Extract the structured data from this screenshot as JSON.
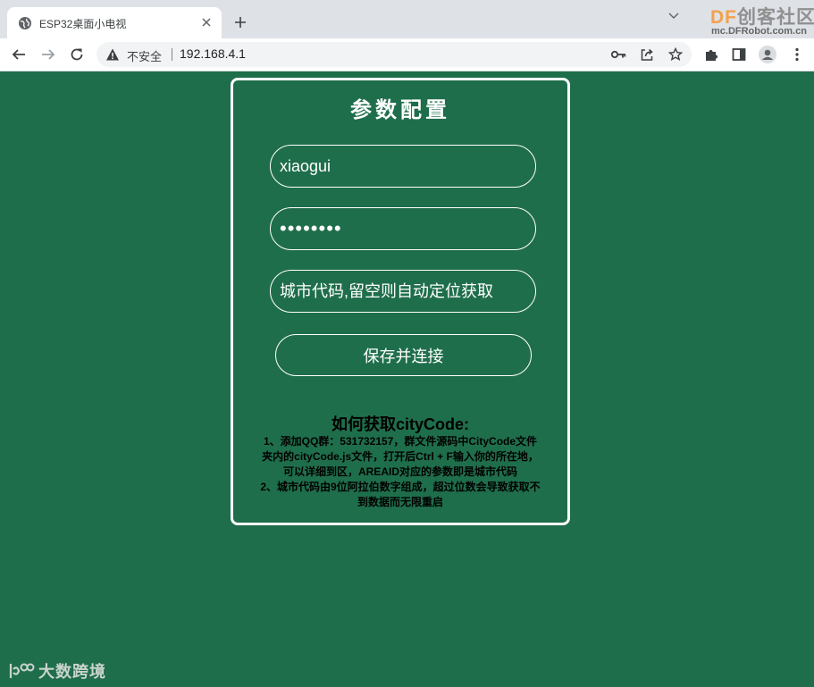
{
  "browser": {
    "tab_title": "ESP32桌面小电视",
    "security_label": "不安全",
    "url": "192.168.4.1"
  },
  "watermark": {
    "logo_prefix": "DF",
    "logo_suffix": "创客社区",
    "url": "mc.DFRobot.com.cn",
    "bottom_text": "大数跨境"
  },
  "colors": {
    "page_background": "#1f6e4b",
    "card_border": "#ffffff",
    "watermark_accent": "#f2a14b"
  },
  "form": {
    "title": "参数配置",
    "ssid_value": "xiaogui",
    "password_value": "12345678",
    "city_code_value": "",
    "city_code_placeholder": "城市代码,留空则自动定位获取",
    "save_button": "保存并连接"
  },
  "help": {
    "title": "如何获取cityCode:",
    "lines": [
      "1、添加QQ群：531732157，群文件源码中CityCode文件",
      "夹内的cityCode.js文件，打开后Ctrl + F输入你的所在地，",
      "可以详细到区，AREAID对应的参数即是城市代码",
      "2、城市代码由9位阿拉伯数字组成，超过位数会导致获取不",
      "到数据而无限重启"
    ]
  }
}
